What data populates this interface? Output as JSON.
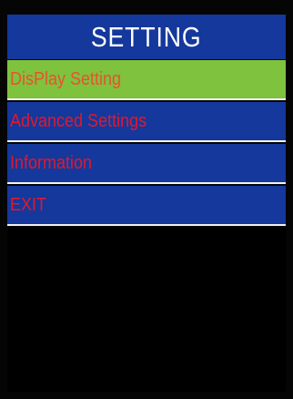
{
  "title": "SETTING",
  "menu": {
    "items": [
      {
        "label": "DisPlay Setting",
        "selected": true
      },
      {
        "label": "Advanced Settings",
        "selected": false
      },
      {
        "label": "Information",
        "selected": false
      },
      {
        "label": "EXIT",
        "selected": false
      }
    ]
  },
  "colors": {
    "title_bg": "#14389c",
    "title_text": "#ffffff",
    "item_bg": "#14389c",
    "selected_bg": "#7fc23e",
    "item_text": "#e2182d",
    "selected_text": "#e7532c",
    "divider": "#f2f2f2",
    "background": "#000000"
  }
}
